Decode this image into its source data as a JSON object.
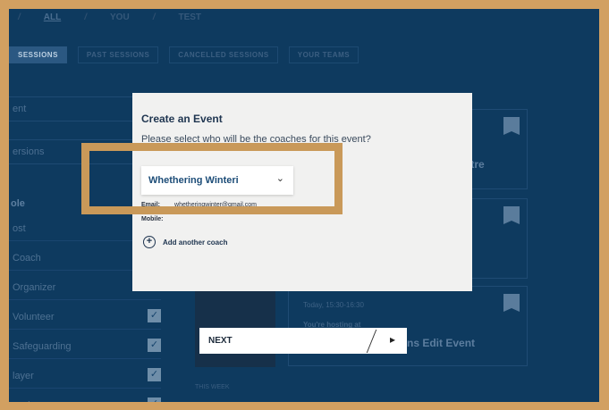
{
  "filters": [
    "ALL",
    "YOU",
    "TEST"
  ],
  "tabs": [
    "SESSIONS",
    "PAST SESSIONS",
    "CANCELLED SESSIONS",
    "YOUR TEAMS"
  ],
  "sidebar": {
    "inputs": [
      "ent",
      "ersions"
    ],
    "heading": "ole",
    "roles": [
      "ost",
      "Coach",
      "Organizer",
      "Volunteer",
      "Safeguarding",
      "layer",
      "ession"
    ]
  },
  "cards": [
    {
      "title_fragment": "ntre"
    },
    {
      "time": "Today, 15:30-16:30",
      "hosting": "You're hosting at",
      "title_fragment": "ns Edit Event"
    }
  ],
  "tile_label": "THIS WEEK",
  "modal": {
    "title": "Create an Event",
    "description": "Please select who will be the coaches for this event?",
    "coach_select_value": "Whethering Winteri",
    "email_label": "Email:",
    "email_value": "whetheringwinter@gmail.com",
    "mobile_label": "Mobile:",
    "add_coach_label": "Add another coach"
  },
  "next_label": "NEXT",
  "colors": {
    "highlight": "#c99959",
    "background": "#0e3a5f"
  }
}
